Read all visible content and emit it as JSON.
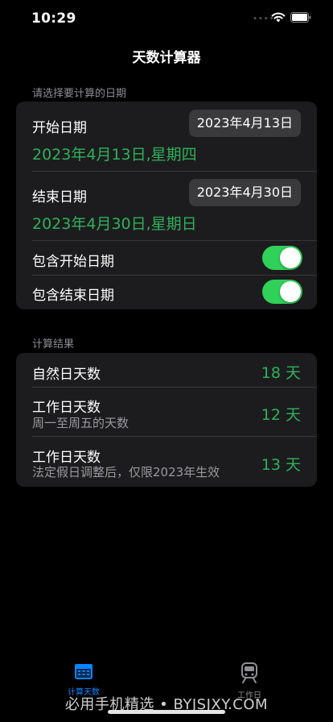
{
  "status_bar": {
    "time": "10:29",
    "dots": "•••••"
  },
  "nav": {
    "title": "天数计算器"
  },
  "select_section": {
    "header": "请选择要计算的日期",
    "start_label": "开始日期",
    "start_button": "2023年4月13日",
    "start_full": "2023年4月13日,星期四",
    "end_label": "结束日期",
    "end_button": "2023年4月30日",
    "end_full": "2023年4月30日,星期日",
    "include_start_label": "包含开始日期",
    "include_start_on": true,
    "include_end_label": "包含结束日期",
    "include_end_on": true
  },
  "result_section": {
    "header": "计算结果",
    "rows": [
      {
        "title": "自然日天数",
        "subtitle": "",
        "value": "18 天"
      },
      {
        "title": "工作日天数",
        "subtitle": "周一至周五的天数",
        "value": "12 天"
      },
      {
        "title": "工作日天数",
        "subtitle": "法定假日调整后，仅限2023年生效",
        "value": "13 天"
      }
    ]
  },
  "tabs": [
    {
      "label": "计算天数",
      "icon": "calendar-icon",
      "active": true
    },
    {
      "label": "工作日",
      "icon": "train-icon",
      "active": false
    }
  ],
  "watermark": "必用手机精选 • BYJSJXY.COM",
  "colors": {
    "accent_green": "#30b05a",
    "toggle_green": "#30d158",
    "tab_active": "#0a84ff",
    "card_bg": "#1c1c1e"
  }
}
